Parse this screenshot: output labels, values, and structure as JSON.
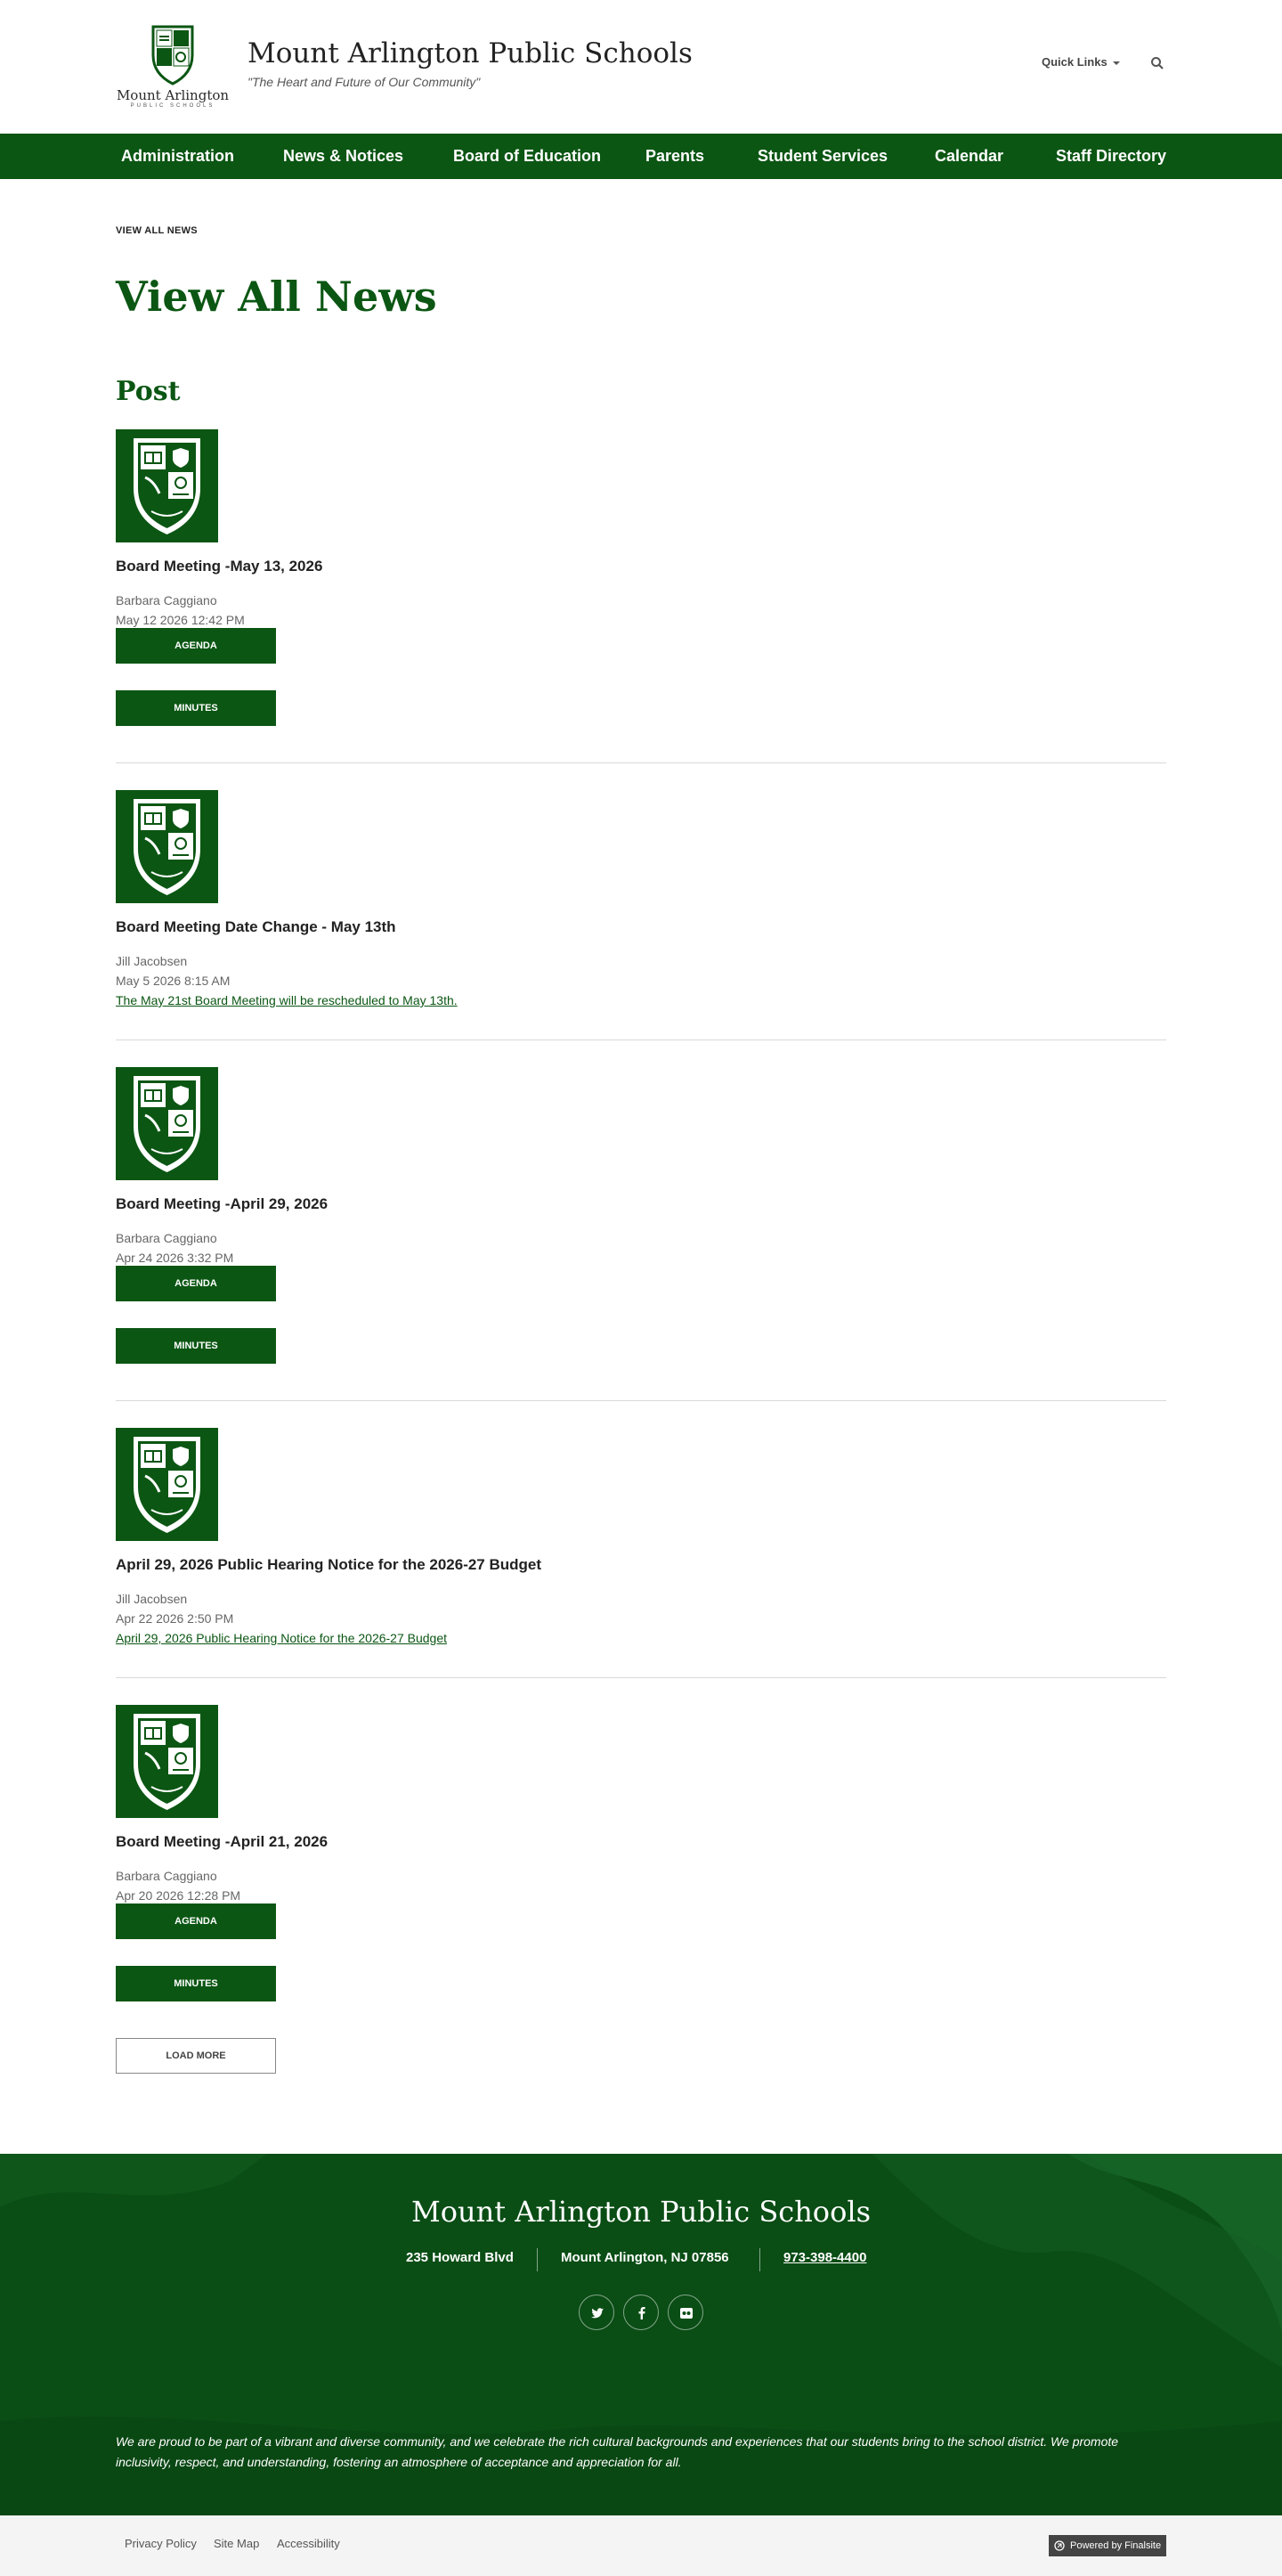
{
  "header": {
    "logo_name": "Mount Arlington",
    "logo_sub": "PUBLIC SCHOOLS",
    "title": "Mount Arlington Public Schools",
    "tagline": "\"The Heart and Future of Our Community\"",
    "quick_links": "Quick Links",
    "search_icon": "search-icon"
  },
  "nav": {
    "items": [
      "Administration",
      "News & Notices",
      "Board of Education",
      "Parents",
      "Student Services",
      "Calendar",
      "Staff Directory"
    ]
  },
  "breadcrumb": "VIEW ALL NEWS",
  "page_title": "View All News",
  "section_title": "Post",
  "posts": [
    {
      "title": "Board Meeting -May 13, 2026",
      "author": "Barbara Caggiano",
      "date": "May 12 2026 12:42 PM",
      "agenda": "AGENDA",
      "minutes": "MINUTES"
    },
    {
      "title": "Board Meeting Date Change - May 13th",
      "author": "Jill Jacobsen",
      "date": "May 5 2026 8:15 AM",
      "link": "The May 21st Board Meeting will be rescheduled to May 13th."
    },
    {
      "title": "Board Meeting -April 29, 2026",
      "author": "Barbara Caggiano",
      "date": "Apr 24 2026 3:32 PM",
      "agenda": "AGENDA",
      "minutes": "MINUTES"
    },
    {
      "title": "April 29, 2026 Public Hearing Notice for the 2026-27 Budget",
      "author": "Jill Jacobsen",
      "date": "Apr 22 2026 2:50 PM",
      "link": "April 29, 2026 Public Hearing Notice for the 2026-27 Budget"
    },
    {
      "title": "Board Meeting -April 21, 2026",
      "author": "Barbara Caggiano",
      "date": "Apr 20 2026 12:28 PM",
      "agenda": "AGENDA",
      "minutes": "MINUTES"
    }
  ],
  "load_more": "LOAD MORE",
  "footer": {
    "name": "Mount Arlington Public Schools",
    "street": "235 Howard Blvd",
    "city": "Mount Arlington, NJ  07856",
    "phone": "973-398-4400",
    "social": [
      "twitter-icon",
      "facebook-icon",
      "flickr-icon"
    ],
    "statement": "We are proud to be part of a vibrant and diverse community, and we celebrate the rich cultural backgrounds and experiences that our students bring to the school district. We promote inclusivity, respect, and understanding, fostering an atmosphere of acceptance and appreciation for all."
  },
  "bottom_bar": {
    "links": [
      "Privacy Policy",
      "Site Map",
      "Accessibility"
    ],
    "powered_by": "Powered by Finalsite"
  },
  "colors": {
    "brand_green": "#0b5613",
    "footer_green": "#0a4d15"
  }
}
